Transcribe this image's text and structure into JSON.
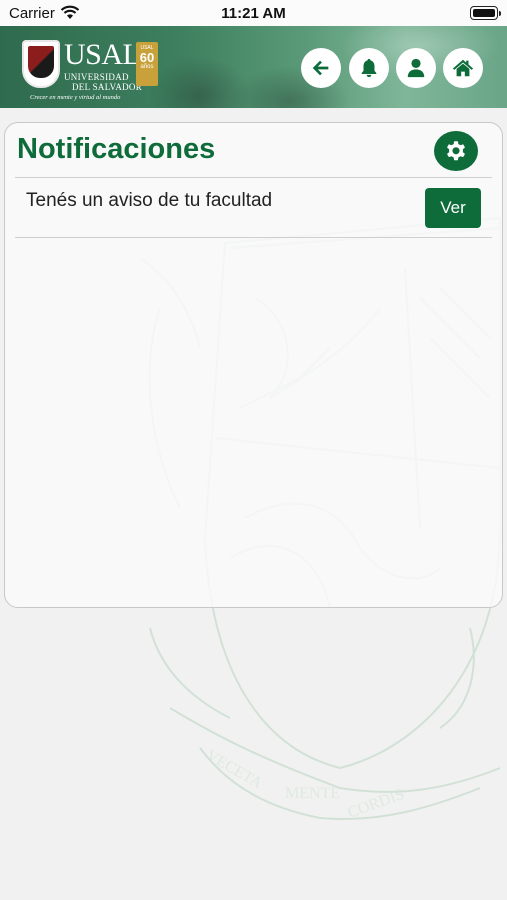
{
  "status_bar": {
    "carrier": "Carrier",
    "time": "11:21 AM"
  },
  "header": {
    "logo_name": "USAL",
    "logo_line1": "UNIVERSIDAD",
    "logo_line2": "DEL SALVADOR",
    "logo_tagline": "Crecer en mente y virtud al mundo",
    "badge_small": "USAL",
    "badge_number": "60",
    "badge_label": "años",
    "nav_icons": [
      "back-arrow-icon",
      "bell-icon",
      "user-icon",
      "home-icon"
    ]
  },
  "card": {
    "title": "Notificaciones",
    "settings_icon": "gear-icon",
    "notifications": [
      {
        "text": "Tenés un aviso de tu facultad",
        "action_label": "Ver"
      }
    ]
  },
  "colors": {
    "primary_green": "#0e6b3a",
    "background": "#f1f1f1"
  }
}
